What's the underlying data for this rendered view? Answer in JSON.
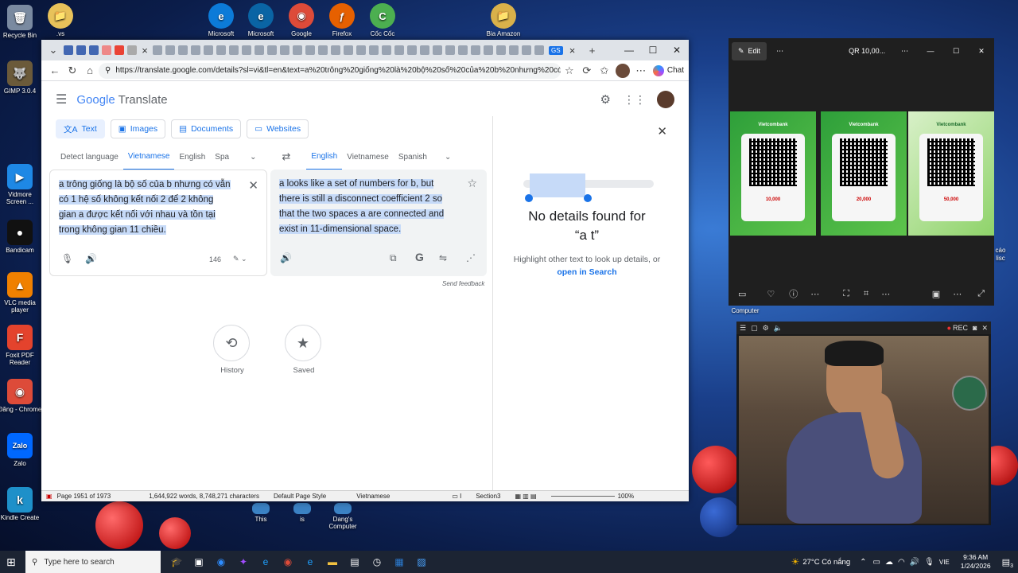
{
  "desktop": {
    "left_icons": [
      {
        "label": "Recycle Bin",
        "glyph": "🗑",
        "color": "#7a8aa0"
      },
      {
        "label": "GIMP 3.0.4",
        "glyph": "🐺",
        "color": "#6b5a3a"
      },
      {
        "label": "Vidmore Screen ...",
        "glyph": "▶",
        "color": "#1e88e5"
      },
      {
        "label": "Bandicam",
        "glyph": "●",
        "color": "#111111"
      },
      {
        "label": "VLC media player",
        "glyph": "▲",
        "color": "#f08000"
      },
      {
        "label": "Foxit PDF Reader",
        "glyph": "F",
        "color": "#e4432d"
      },
      {
        "label": "Đăng - Chrome",
        "glyph": "◉",
        "color": "#dd4b39"
      },
      {
        "label": "Zalo",
        "glyph": "Zalo",
        "color": "#0068ff"
      },
      {
        "label": "Kindle Create",
        "glyph": "k",
        "color": "#1e90c9"
      }
    ],
    "top_icons": [
      {
        "label": ".vs",
        "glyph": "📁",
        "color": "#e8c25a"
      },
      {
        "label": "Microsoft",
        "glyph": "e",
        "color": "#0c7bd8"
      },
      {
        "label": "Microsoft",
        "glyph": "e",
        "color": "#0a64a4"
      },
      {
        "label": "Google",
        "glyph": "◉",
        "color": "#dd4b39"
      },
      {
        "label": "Firefox",
        "glyph": "ƒ",
        "color": "#e66000"
      },
      {
        "label": "Cốc Cốc",
        "glyph": "C",
        "color": "#4caf50"
      },
      {
        "label": "Bia Amazon",
        "glyph": "📁",
        "color": "#d9b14a"
      }
    ],
    "bottom_icons": [
      {
        "label": "This"
      },
      {
        "label": "is"
      },
      {
        "label": "Dang's Computer"
      }
    ],
    "partial_labels": {
      "right_edge": "cáo",
      "right_edge_2": "lisc",
      "computer": "Computer"
    }
  },
  "browser": {
    "tab_close": "×",
    "new_tab": "+",
    "gs_badge": "GS",
    "url": "https://translate.google.com/details?sl=vi&tl=en&text=a%20trông%20giống%20là%20bộ%20số%20của%20b%20nhưng%20có%...",
    "chat_label": "Chat",
    "app_title_google": "Google",
    "app_title_translate": "Translate",
    "modes": [
      "Text",
      "Images",
      "Documents",
      "Websites"
    ],
    "source_langs": [
      "Detect language",
      "Vietnamese",
      "English",
      "Spa"
    ],
    "target_langs": [
      "English",
      "Vietnamese",
      "Spanish"
    ],
    "source_text": "a trông giống là bộ số của b nhưng có vẫn có 1 hệ số không kết nối 2 để 2 không gian a được kết nối với nhau và tồn tại trong không gian 11 chiều.",
    "source_lines": [
      "a trông giống là bộ số của b nhưng có vẫn",
      "có 1 hệ số không kết nối 2 để 2 không",
      "gian a được kết nối với nhau và tồn tại",
      "trong không gian 11 chiều."
    ],
    "char_count": "146",
    "target_lines": [
      "a looks like a set of numbers for b, but",
      "there is still a disconnect coefficient 2 so",
      "that the two spaces a are connected and",
      "exist in 11-dimensional space."
    ],
    "send_feedback": "Send feedback",
    "history_label": "History",
    "saved_label": "Saved",
    "details_title": "No details found for",
    "details_query": "“a t”",
    "details_hint": "Highlight other text to look up details, or",
    "details_link": "open in Search",
    "status": {
      "page": "Page 1951 of 1973",
      "words": "1,644,922 words, 8,748,271 characters",
      "style": "Default Page Style",
      "language": "Vietnamese",
      "section": "Section3",
      "zoom": "100%"
    }
  },
  "viewer": {
    "edit_label": "Edit",
    "title": "QR 10,00...",
    "bank": "Vietcombank",
    "amounts": [
      "10,000",
      "20,000",
      "50,000"
    ]
  },
  "webcam": {
    "rec_label": "REC"
  },
  "taskbar": {
    "search_placeholder": "Type here to search",
    "weather": "27°C  Có nắng",
    "lang": "VIE",
    "time": "9:36 AM",
    "date": "1/24/2026",
    "notif_count": "3"
  }
}
